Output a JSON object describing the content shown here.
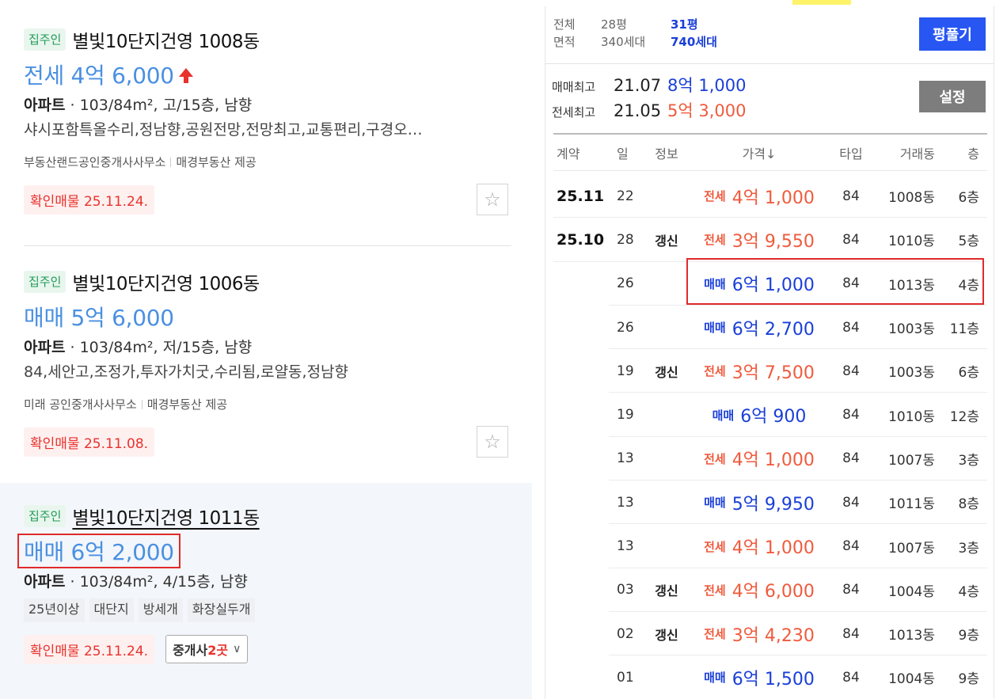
{
  "left": {
    "listings": [
      {
        "badge": "집주인",
        "complex": "별빛10단지건영 1008동",
        "price": "전세 4억 6,000",
        "type": "아파트",
        "spec": " · 103/84m², 고/15층, 남향",
        "desc": "샤시포함특올수리,정남향,공원전망,전망최고,교통편리,구경오…",
        "agency": "부동산랜드공인중개사사무소",
        "provider": "매경부동산 제공",
        "confirm": "확인매물 25.11.24."
      },
      {
        "badge": "집주인",
        "complex": "별빛10단지건영 1006동",
        "price": "매매 5억 6,000",
        "type": "아파트",
        "spec": " · 103/84m², 저/15층, 남향",
        "desc": "84,세안고,조정가,투자가치굿,수리됨,로얄동,정남향",
        "agency": "미래 공인중개사사무소",
        "provider": "매경부동산 제공",
        "confirm": "확인매물 25.11.08."
      },
      {
        "badge": "집주인",
        "complex": "별빛10단지건영 1011동",
        "price": "매매 6억 2,000",
        "type": "아파트",
        "spec": " · 103/84m², 4/15층, 남향",
        "tags": [
          "25년이상",
          "대단지",
          "방세개",
          "화장실두개"
        ],
        "confirm": "확인매물 25.11.24.",
        "broker_prefix": "중개사 ",
        "broker_count": "2곳"
      }
    ]
  },
  "right": {
    "area": {
      "row1": {
        "label": "전체",
        "opt1": "28평",
        "opt2": "31평"
      },
      "row2": {
        "label": "면적",
        "opt1": "340세대",
        "opt2": "740세대"
      }
    },
    "expand_button": "평풀기",
    "settings_button": "설정",
    "max_sale": {
      "label": "매매최고",
      "date": "21.07",
      "value": "8억 1,000"
    },
    "max_jeonse": {
      "label": "전세최고",
      "date": "21.05",
      "value": "5억 3,000"
    },
    "headers": [
      "계약",
      "일",
      "정보",
      "가격↓",
      "타입",
      "거래동",
      "층"
    ],
    "rows": [
      {
        "month": "25.11",
        "day": "22",
        "info": "",
        "kind": "전세",
        "price": "4억 1,000",
        "type": "84",
        "dong": "1008동",
        "floor": "6층"
      },
      {
        "month": "25.10",
        "day": "28",
        "info": "갱신",
        "kind": "전세",
        "price": "3억 9,550",
        "type": "84",
        "dong": "1010동",
        "floor": "5층"
      },
      {
        "month": "",
        "day": "26",
        "info": "",
        "kind": "매매",
        "price": "6억 1,000",
        "type": "84",
        "dong": "1013동",
        "floor": "4층"
      },
      {
        "month": "",
        "day": "26",
        "info": "",
        "kind": "매매",
        "price": "6억 2,700",
        "type": "84",
        "dong": "1003동",
        "floor": "11층"
      },
      {
        "month": "",
        "day": "19",
        "info": "갱신",
        "kind": "전세",
        "price": "3억 7,500",
        "type": "84",
        "dong": "1003동",
        "floor": "6층"
      },
      {
        "month": "",
        "day": "19",
        "info": "",
        "kind": "매매",
        "price": "6억 900",
        "type": "84",
        "dong": "1010동",
        "floor": "12층"
      },
      {
        "month": "",
        "day": "13",
        "info": "",
        "kind": "전세",
        "price": "4억 1,000",
        "type": "84",
        "dong": "1007동",
        "floor": "3층"
      },
      {
        "month": "",
        "day": "13",
        "info": "",
        "kind": "매매",
        "price": "5억 9,950",
        "type": "84",
        "dong": "1011동",
        "floor": "8층"
      },
      {
        "month": "",
        "day": "13",
        "info": "",
        "kind": "전세",
        "price": "4억 1,000",
        "type": "84",
        "dong": "1007동",
        "floor": "3층"
      },
      {
        "month": "",
        "day": "03",
        "info": "갱신",
        "kind": "전세",
        "price": "4억 6,000",
        "type": "84",
        "dong": "1004동",
        "floor": "4층"
      },
      {
        "month": "",
        "day": "02",
        "info": "갱신",
        "kind": "전세",
        "price": "3억 4,230",
        "type": "84",
        "dong": "1013동",
        "floor": "9층"
      },
      {
        "month": "",
        "day": "01",
        "info": "",
        "kind": "매매",
        "price": "6억 1,500",
        "type": "84",
        "dong": "1004동",
        "floor": "9층"
      }
    ]
  },
  "colors": {
    "price_blue": "#4a90e2",
    "sale_blue": "#1a3fd8",
    "jeonse_red": "#ef5b3d",
    "highlight_red": "#e02a2a",
    "button_blue": "#2756f3",
    "button_gray": "#7d7d7d",
    "owner_green": "#1e9b57"
  }
}
